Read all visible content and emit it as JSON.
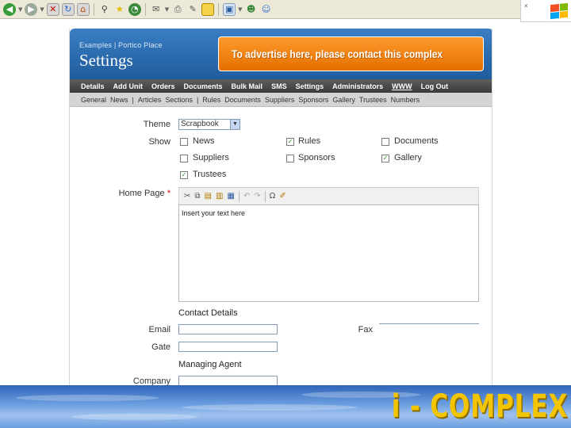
{
  "browser": {
    "toolbar_icons": [
      "back-icon",
      "forward-icon",
      "stop-icon",
      "refresh-icon",
      "home-icon",
      "search-icon",
      "favorites-icon",
      "history-icon",
      "mail-icon",
      "print-icon",
      "edit-icon",
      "discuss-icon",
      "research-icon",
      "messenger-icon"
    ],
    "close_glyph": "×"
  },
  "header": {
    "breadcrumb": "Examples | Portico Place",
    "title": "Settings",
    "ad_text": "To advertise here, please contact this complex"
  },
  "main_nav": {
    "items": [
      "Details",
      "Add Unit",
      "Orders",
      "Documents",
      "Bulk Mail",
      "SMS",
      "Settings",
      "Administrators",
      "WWW",
      "Log Out"
    ],
    "active": "WWW"
  },
  "sub_nav": {
    "items": [
      "General",
      "News",
      "|",
      "Articles",
      "Sections",
      "|",
      "Rules",
      "Documents",
      "Suppliers",
      "Sponsors",
      "Gallery",
      "Trustees",
      "Numbers"
    ]
  },
  "form": {
    "theme_label": "Theme",
    "theme_value": "Scrapbook",
    "show_label": "Show",
    "show_options": [
      {
        "label": "News",
        "checked": false
      },
      {
        "label": "Rules",
        "checked": true
      },
      {
        "label": "Documents",
        "checked": false
      },
      {
        "label": "Suppliers",
        "checked": false
      },
      {
        "label": "Sponsors",
        "checked": false
      },
      {
        "label": "Gallery",
        "checked": true
      },
      {
        "label": "Trustees",
        "checked": true
      }
    ],
    "home_page_label": "Home Page",
    "required_mark": "*",
    "editor_placeholder": "Insert your text here",
    "editor_buttons": [
      "cut-icon",
      "copy-icon",
      "paste-icon",
      "paste-text-icon",
      "paste-word-icon",
      "undo-icon",
      "redo-icon",
      "special-char-icon",
      "clean-icon"
    ],
    "contact_heading": "Contact Details",
    "email_label": "Email",
    "fax_label": "Fax",
    "gate_label": "Gate",
    "agent_heading": "Managing Agent",
    "company_label": "Company"
  },
  "footer": {
    "brand": "i - COMPLEX"
  }
}
